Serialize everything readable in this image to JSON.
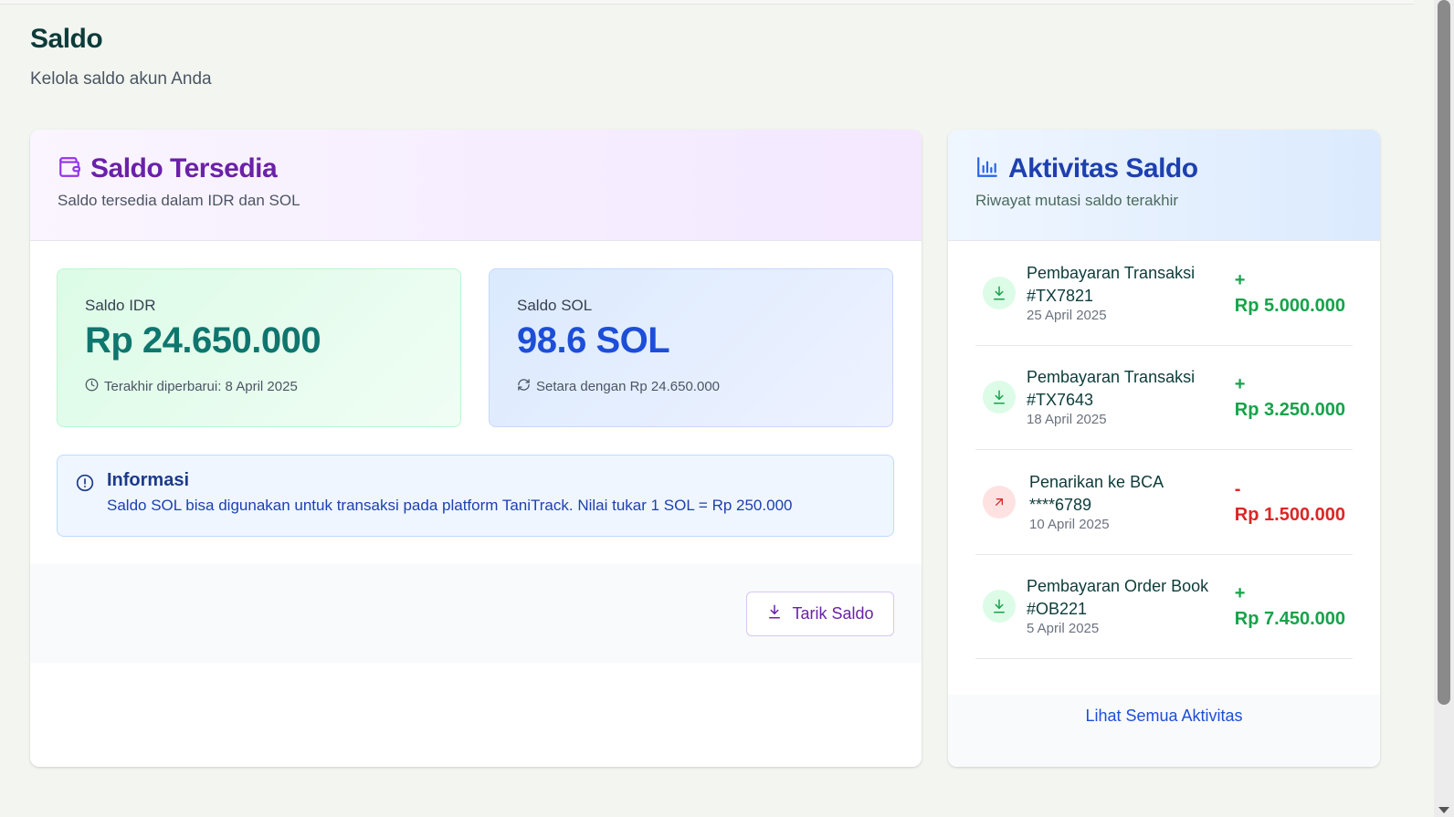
{
  "page": {
    "title": "Saldo",
    "subtitle": "Kelola saldo akun Anda"
  },
  "balance_card": {
    "icon": "wallet-icon",
    "title": "Saldo Tersedia",
    "subtitle": "Saldo tersedia dalam IDR dan SOL",
    "idr": {
      "label": "Saldo IDR",
      "value": "Rp 24.650.000",
      "meta_icon": "clock-icon",
      "meta": "Terakhir diperbarui: 8 April 2025"
    },
    "sol": {
      "label": "Saldo SOL",
      "value": "98.6 SOL",
      "meta_icon": "refresh-icon",
      "meta": "Setara dengan Rp 24.650.000"
    },
    "info": {
      "icon": "alert-circle-icon",
      "title": "Informasi",
      "text": "Saldo SOL bisa digunakan untuk transaksi pada platform TaniTrack. Nilai tukar 1 SOL = Rp 250.000"
    },
    "withdraw_button": "Tarik Saldo"
  },
  "activity_card": {
    "icon": "bar-chart-icon",
    "title": "Aktivitas Saldo",
    "subtitle": "Riwayat mutasi saldo terakhir",
    "items": [
      {
        "type": "in",
        "icon": "download-icon",
        "title": "Pembayaran Transaksi #TX7821",
        "date": "25 April 2025",
        "sign": "+",
        "amount": "Rp 5.000.000"
      },
      {
        "type": "in",
        "icon": "download-icon",
        "title": "Pembayaran Transaksi #TX7643",
        "date": "18 April 2025",
        "sign": "+",
        "amount": "Rp 3.250.000"
      },
      {
        "type": "out",
        "icon": "arrow-up-right-icon",
        "title": "Penarikan ke BCA ****6789",
        "date": "10 April 2025",
        "sign": "-",
        "amount": "Rp 1.500.000"
      },
      {
        "type": "in",
        "icon": "download-icon",
        "title": "Pembayaran Order Book #OB221",
        "date": "5 April 2025",
        "sign": "+",
        "amount": "Rp 7.450.000"
      }
    ],
    "view_all": "Lihat Semua Aktivitas"
  },
  "colors": {
    "purple_accent": "#6b21a8",
    "blue_accent": "#1d4ed8",
    "green_positive": "#16a34a",
    "red_negative": "#dc2626",
    "teal_value": "#0f766e"
  }
}
